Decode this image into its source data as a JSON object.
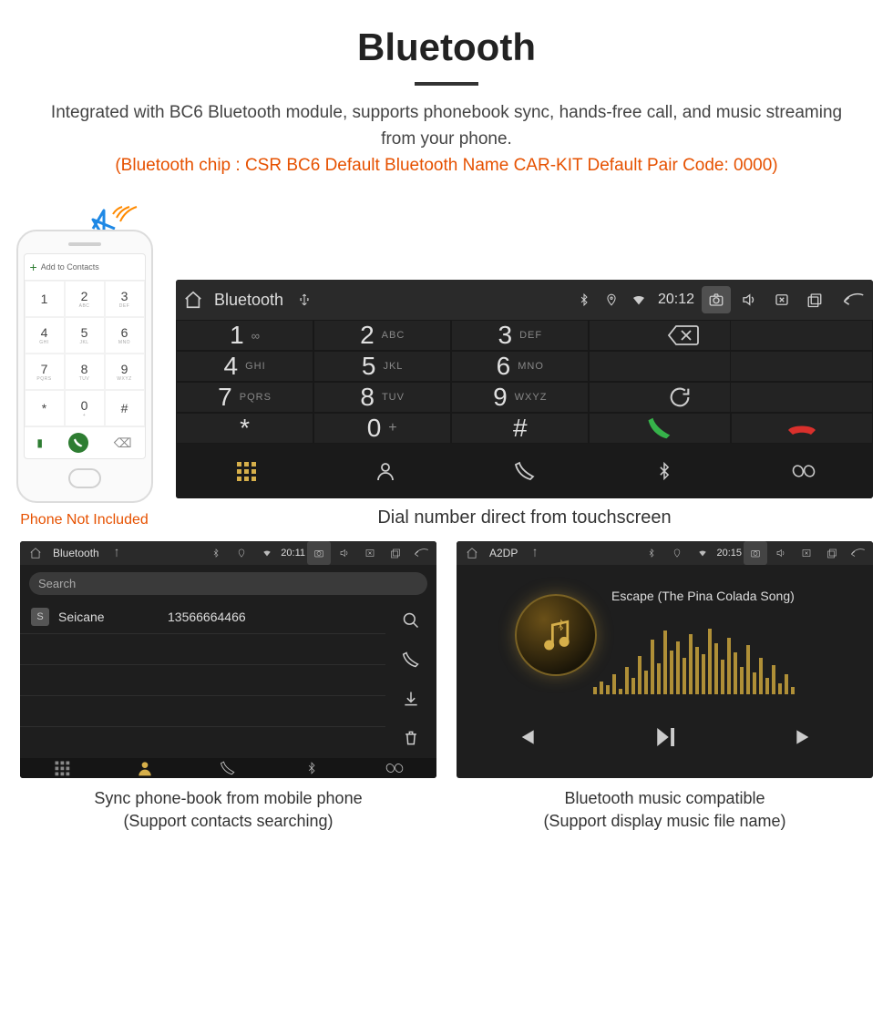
{
  "header": {
    "title": "Bluetooth",
    "subtitle": "Integrated with BC6 Bluetooth module, supports phonebook sync, hands-free call, and music streaming from your phone.",
    "specs": "(Bluetooth chip : CSR BC6     Default Bluetooth Name CAR-KIT    Default Pair Code: 0000)"
  },
  "phone": {
    "add_label": "Add to Contacts",
    "caption": "Phone Not Included",
    "keys": [
      {
        "num": "1",
        "sub": ""
      },
      {
        "num": "2",
        "sub": "ABC"
      },
      {
        "num": "3",
        "sub": "DEF"
      },
      {
        "num": "4",
        "sub": "GHI"
      },
      {
        "num": "5",
        "sub": "JKL"
      },
      {
        "num": "6",
        "sub": "MNO"
      },
      {
        "num": "7",
        "sub": "PQRS"
      },
      {
        "num": "8",
        "sub": "TUV"
      },
      {
        "num": "9",
        "sub": "WXYZ"
      },
      {
        "num": "*",
        "sub": ""
      },
      {
        "num": "0",
        "sub": "+"
      },
      {
        "num": "#",
        "sub": ""
      }
    ]
  },
  "dialer": {
    "status": {
      "app": "Bluetooth",
      "time": "20:12"
    },
    "caption": "Dial number direct from touchscreen",
    "keys": [
      {
        "num": "1",
        "sub": "∞"
      },
      {
        "num": "2",
        "sub": "ABC"
      },
      {
        "num": "3",
        "sub": "DEF"
      },
      {
        "num": "4",
        "sub": "GHI"
      },
      {
        "num": "5",
        "sub": "JKL"
      },
      {
        "num": "6",
        "sub": "MNO"
      },
      {
        "num": "7",
        "sub": "PQRS"
      },
      {
        "num": "8",
        "sub": "TUV"
      },
      {
        "num": "9",
        "sub": "WXYZ"
      },
      {
        "num": "*",
        "sub": ""
      },
      {
        "num": "0",
        "sub": "+"
      },
      {
        "num": "#",
        "sub": ""
      }
    ]
  },
  "phonebook": {
    "status": {
      "app": "Bluetooth",
      "time": "20:11"
    },
    "search_placeholder": "Search",
    "contact": {
      "initial": "S",
      "name": "Seicane",
      "number": "13566664466"
    },
    "caption_line1": "Sync phone-book from mobile phone",
    "caption_line2": "(Support contacts searching)"
  },
  "music": {
    "status": {
      "app": "A2DP",
      "time": "20:15"
    },
    "song": "Escape (The Pina Colada Song)",
    "eq_heights": [
      8,
      14,
      10,
      22,
      6,
      30,
      18,
      42,
      26,
      60,
      34,
      70,
      48,
      58,
      40,
      66,
      52,
      44,
      72,
      56,
      38,
      62,
      46,
      30,
      54,
      24,
      40,
      18,
      32,
      12,
      22,
      8
    ],
    "caption_line1": "Bluetooth music compatible",
    "caption_line2": "(Support display music file name)"
  },
  "colors": {
    "accent_green": "#36b24a",
    "accent_red": "#d9302c",
    "accent_gold": "#d6af4a",
    "accent_orange": "#e65100"
  }
}
